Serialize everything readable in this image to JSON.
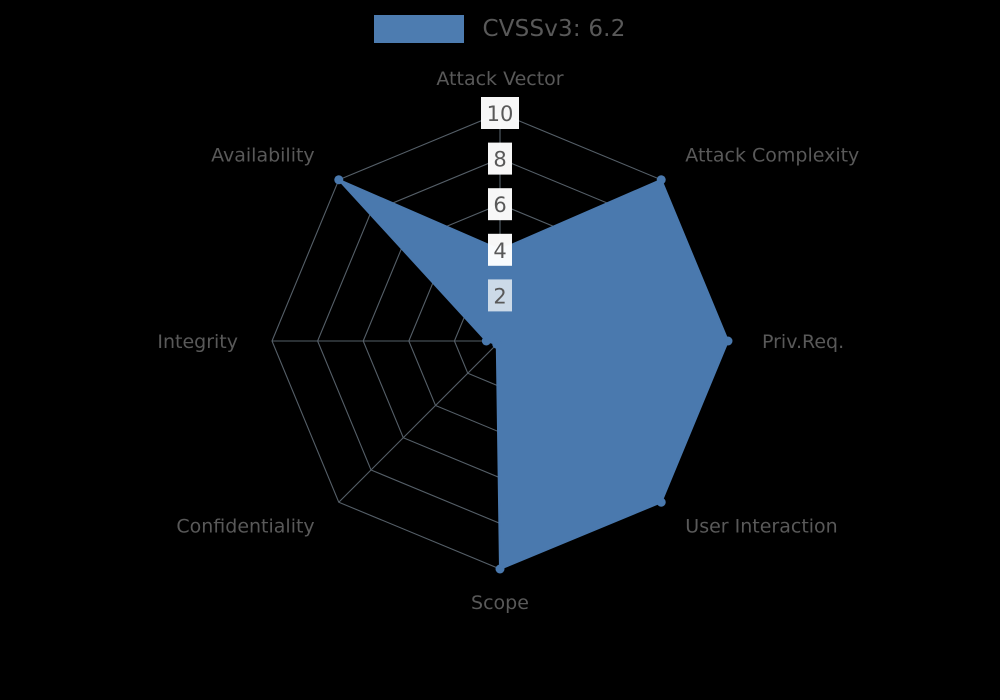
{
  "legend": {
    "series_label": "CVSSv3: 6.2",
    "swatch_color": "#4d7cb0",
    "swatch_name": "cvssv3-color-swatch"
  },
  "colors": {
    "background": "#000000",
    "series_fill": "#4a79ae",
    "series_stroke": "#4a79ae",
    "grid": "#555f68",
    "text": "#595959",
    "tick_box": "#ffffff"
  },
  "geometry": {
    "center_x": 500,
    "center_y": 341,
    "max_radius": 228,
    "axis_count": 8,
    "ring_count": 5
  },
  "chart_data": {
    "type": "radar",
    "title": "",
    "subtitle": "",
    "xlabel": "",
    "ylabel": "",
    "grid": true,
    "legend_position": "top-center",
    "rlim": [
      0,
      10
    ],
    "tick_values": [
      2,
      4,
      6,
      8,
      10
    ],
    "tick_labels": [
      "2",
      "4",
      "6",
      "8",
      "10"
    ],
    "categories": [
      "Attack Vector",
      "Attack Complexity",
      "Priv.Req.",
      "User Interaction",
      "Scope",
      "Confidentiality",
      "Integrity",
      "Availability"
    ],
    "series": [
      {
        "name": "CVSSv3: 6.2",
        "color": "#4a79ae",
        "values": [
          4.0,
          10.0,
          10.0,
          10.0,
          10.0,
          0.2,
          0.6,
          10.0
        ]
      }
    ]
  }
}
